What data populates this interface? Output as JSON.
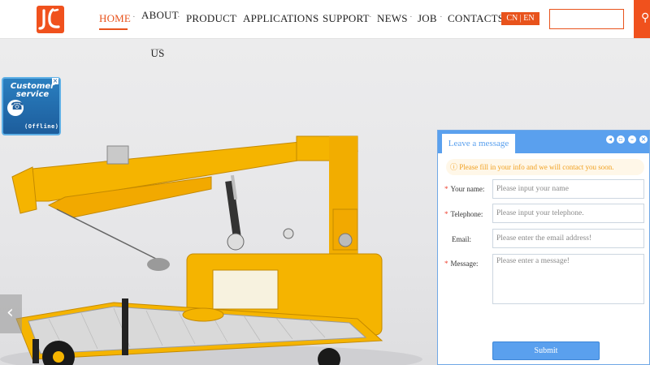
{
  "header": {
    "logo_alt": "JL",
    "nav": [
      {
        "label": "HOME"
      },
      {
        "label": "ABOUT US"
      },
      {
        "label": "PRODUCT"
      },
      {
        "label": "APPLICATIONS"
      },
      {
        "label": "SUPPORT"
      },
      {
        "label": "NEWS"
      },
      {
        "label": "JOB"
      },
      {
        "label": "CONTACTS"
      }
    ],
    "lang": "CN | EN",
    "search_icon": "search-icon",
    "accent_color": "#e8531c"
  },
  "banner": {
    "prev_icon": "chevron-left-icon",
    "product_color": "#f5b400"
  },
  "customer_service": {
    "title": "Customer service",
    "status": "(Offline)",
    "icon": "phone-icon"
  },
  "message_panel": {
    "tab_label": "Leave a message",
    "notice": "Please fill in your info and we will contact you soon.",
    "fields": {
      "name": {
        "label": "Your name:",
        "placeholder": "Please input your name"
      },
      "telephone": {
        "label": "Telephone:",
        "placeholder": "Please input your telephone."
      },
      "email": {
        "label": "Email:",
        "placeholder": "Please enter the email address!"
      },
      "message": {
        "label": "Message:",
        "placeholder": "Please enter a message!"
      }
    },
    "submit_label": "Submit",
    "header_color": "#5aa0ee"
  }
}
